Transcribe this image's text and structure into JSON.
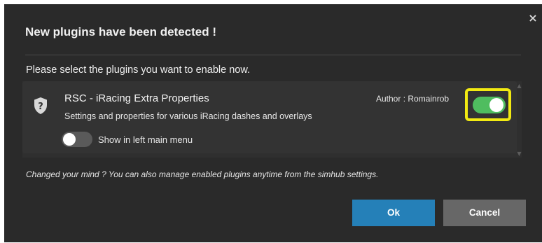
{
  "dialog": {
    "title": "New plugins have been detected !",
    "close_glyph": "×",
    "subtitle": "Please select the plugins you want to enable now.",
    "note": "Changed your mind ? You can also manage enabled plugins anytime from the simhub settings."
  },
  "plugins": [
    {
      "icon": "shield-question-icon",
      "name": "RSC - iRacing Extra Properties",
      "description": "Settings and properties for various iRacing dashes and overlays",
      "author": "Author : Romainrob",
      "enabled": true,
      "show_in_menu_label": "Show in left main menu",
      "show_in_menu": false
    }
  ],
  "buttons": {
    "ok_label": "Ok",
    "cancel_label": "Cancel"
  },
  "colors": {
    "dialog_bg": "#2a2a2a",
    "toggle_on": "#4fbd5f",
    "highlight": "#f2ea12",
    "ok_button": "#2580b8",
    "cancel_button": "#676767"
  }
}
